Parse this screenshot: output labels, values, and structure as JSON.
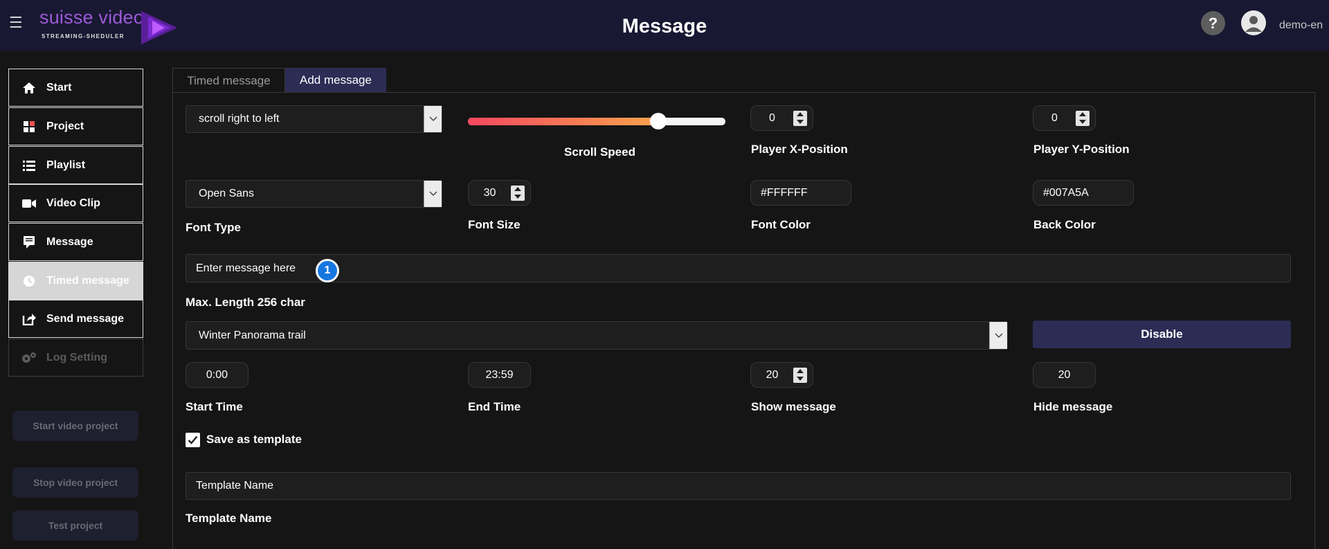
{
  "header": {
    "brand": "suisse video",
    "brand_sub": "STREAMING-SHEDULER",
    "title": "Message",
    "help": "?",
    "username": "demo-en"
  },
  "sidebar": {
    "items": [
      {
        "label": "Start",
        "icon": "home-icon"
      },
      {
        "label": "Project",
        "icon": "grid-icon"
      },
      {
        "label": "Playlist",
        "icon": "list-icon"
      },
      {
        "label": "Video Clip",
        "icon": "video-camera-icon"
      },
      {
        "label": "Message",
        "icon": "message-icon"
      },
      {
        "label": "Timed message",
        "icon": "clock-icon"
      },
      {
        "label": "Send message",
        "icon": "share-icon"
      },
      {
        "label": "Log Setting",
        "icon": "gears-icon"
      }
    ],
    "buttons": {
      "start_project": "Start video project",
      "stop_project": "Stop video project",
      "test_project": "Test project"
    }
  },
  "tabs": [
    {
      "label": "Timed message"
    },
    {
      "label": "Add message"
    }
  ],
  "form": {
    "scroll_mode": "scroll right to left",
    "scroll_speed_label": "Scroll Speed",
    "scroll_speed_fraction": 0.74,
    "player_x": {
      "value": "0",
      "label": "Player X-Position"
    },
    "player_y": {
      "value": "0",
      "label": "Player Y-Position"
    },
    "font_type": {
      "value": "Open Sans",
      "label": "Font Type"
    },
    "font_size": {
      "value": "30",
      "label": "Font Size"
    },
    "font_color": {
      "value": "#FFFFFF",
      "label": "Font Color"
    },
    "back_color": {
      "value": "#007A5A",
      "label": "Back Color"
    },
    "message": {
      "placeholder": "Enter message here",
      "hint": "Max. Length 256 char",
      "badge": "1"
    },
    "playlist": "Winter Panorama trail",
    "disable_label": "Disable",
    "start_time": {
      "value": "0:00",
      "label": "Start Time"
    },
    "end_time": {
      "value": "23:59",
      "label": "End Time"
    },
    "show_message": {
      "value": "20",
      "label": "Show message"
    },
    "hide_message": {
      "value": "20",
      "label": "Hide message"
    },
    "save_template_label": "Save as template",
    "template_name": {
      "placeholder": "Template Name",
      "label": "Template Name"
    }
  },
  "colors": {
    "topbar": "#191832",
    "accent": "#2c2c55",
    "badge": "#1677e0"
  }
}
